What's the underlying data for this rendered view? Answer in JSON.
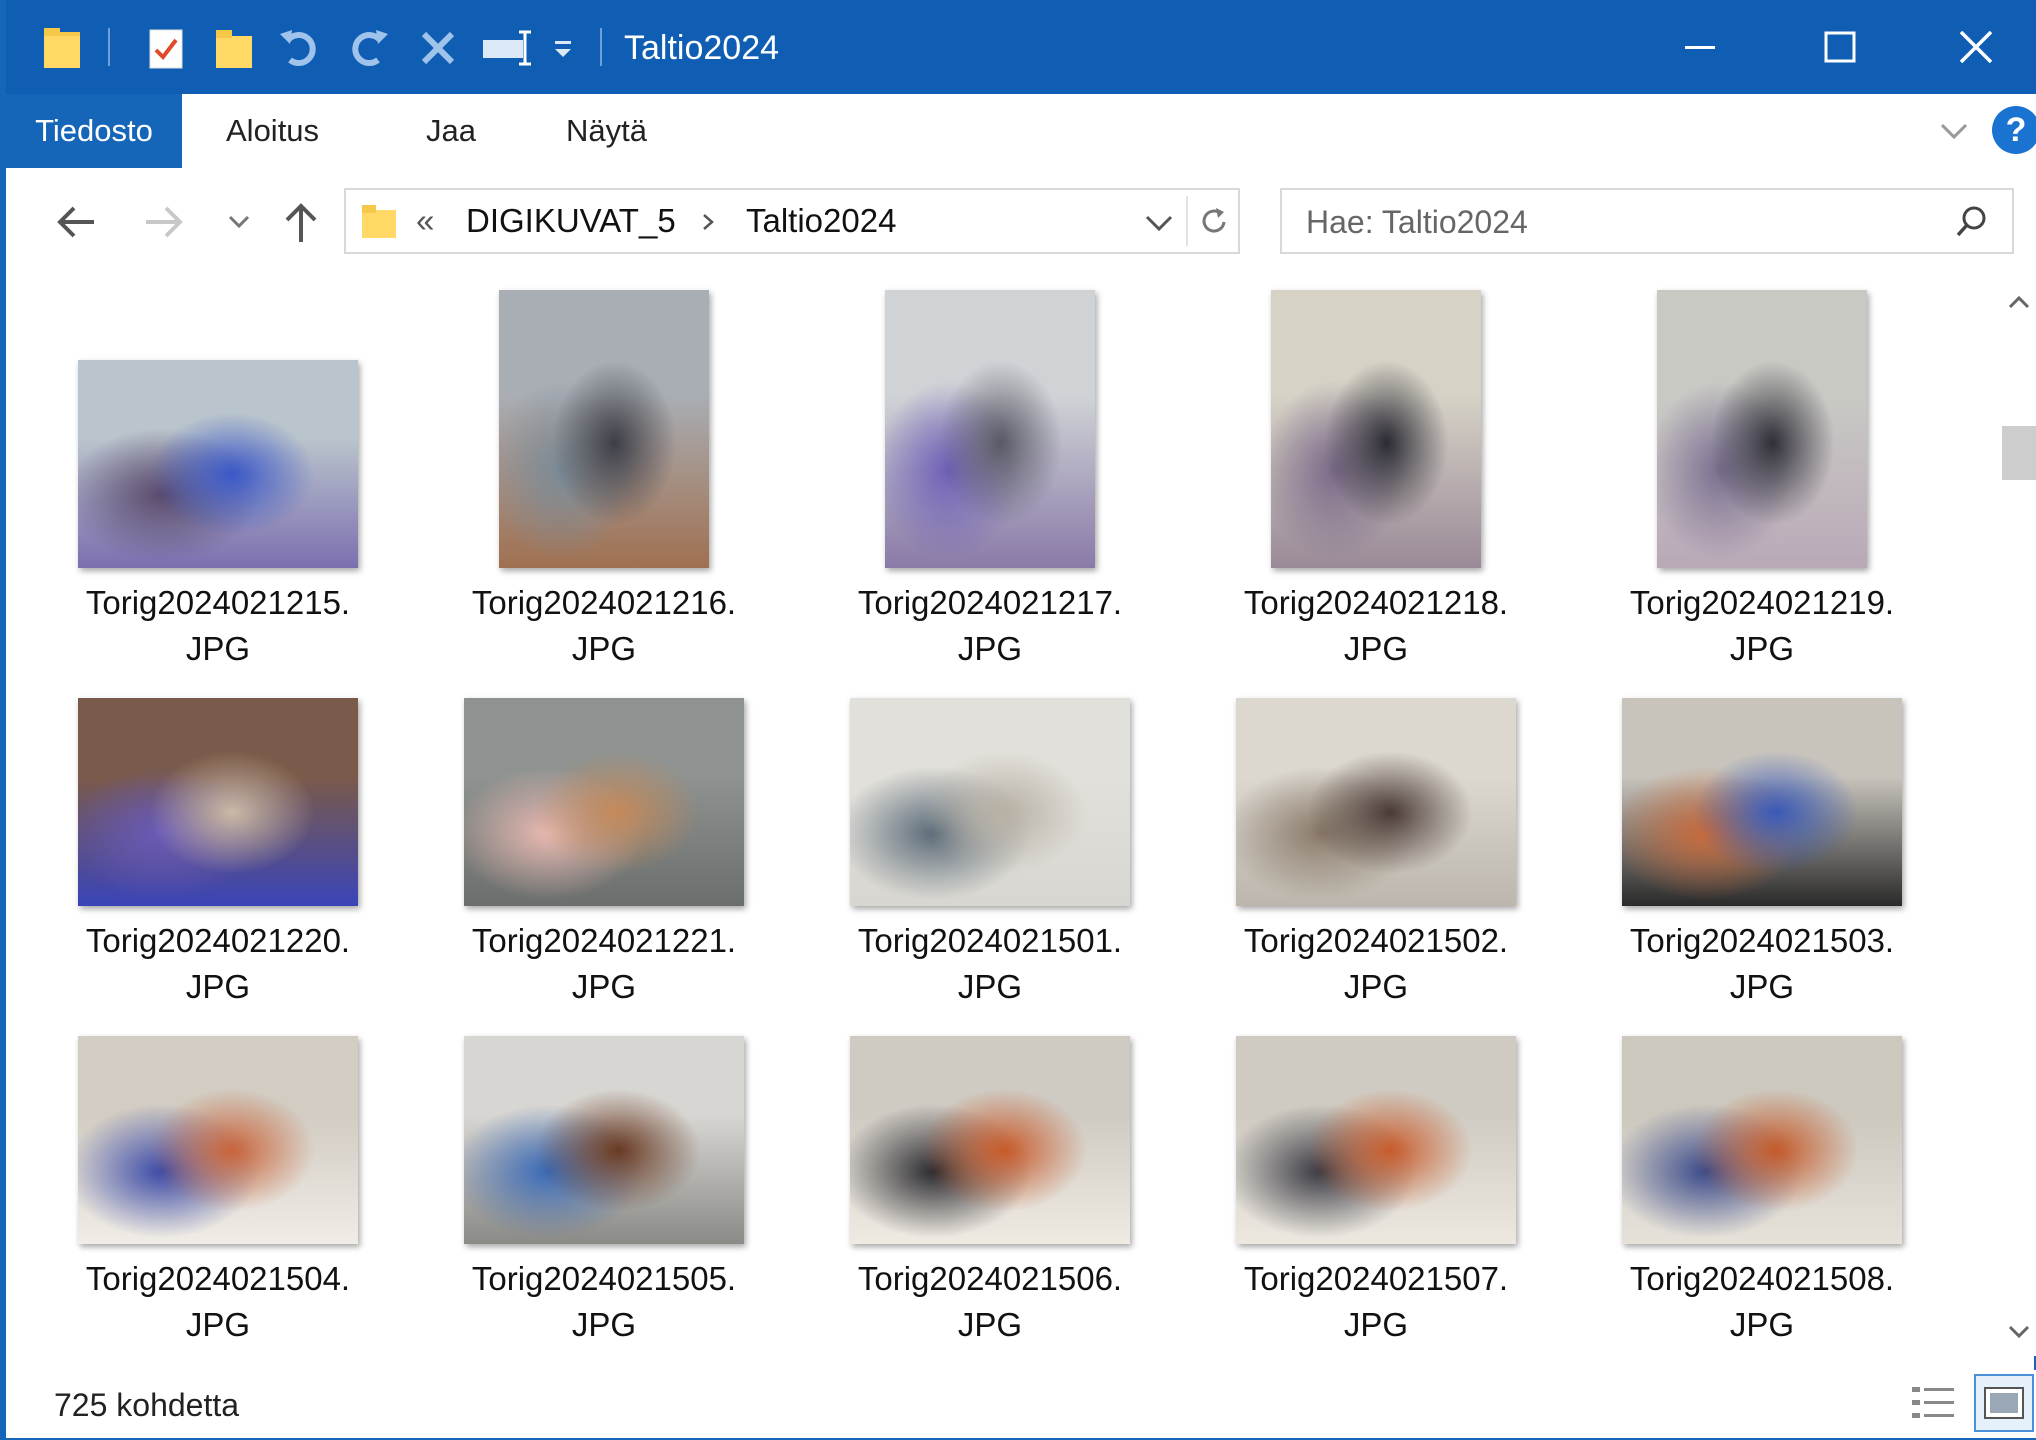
{
  "window": {
    "title": "Taltio2024"
  },
  "ribbon": {
    "tabs": [
      {
        "label": "Tiedosto"
      },
      {
        "label": "Aloitus"
      },
      {
        "label": "Jaa"
      },
      {
        "label": "Näytä"
      }
    ],
    "help_label": "?"
  },
  "address": {
    "overflow": "«",
    "crumbs": [
      "DIGIKUVAT_5",
      "Taltio2024"
    ]
  },
  "search": {
    "placeholder": "Hae: Taltio2024"
  },
  "files": [
    {
      "name": "Torig2024021215.",
      "ext": "JPG",
      "orientation": "landscape",
      "colors": [
        "#b9c4cc",
        "#3a58c8",
        "#5a4a6a",
        "#7c6fb0"
      ]
    },
    {
      "name": "Torig2024021216.",
      "ext": "JPG",
      "orientation": "portrait",
      "colors": [
        "#a9adb4",
        "#3d3f48",
        "#7a8a96",
        "#a07050"
      ]
    },
    {
      "name": "Torig2024021217.",
      "ext": "JPG",
      "orientation": "portrait",
      "colors": [
        "#cfd3d6",
        "#5a5a66",
        "#6f5fb8",
        "#8a7aa8"
      ]
    },
    {
      "name": "Torig2024021218.",
      "ext": "JPG",
      "orientation": "portrait",
      "colors": [
        "#d6d2c6",
        "#2b2b34",
        "#7a6a88",
        "#9a8a98"
      ]
    },
    {
      "name": "Torig2024021219.",
      "ext": "JPG",
      "orientation": "portrait",
      "colors": [
        "#c9c9c4",
        "#2f2f38",
        "#7a6f90",
        "#b9a9b8"
      ]
    },
    {
      "name": "Torig2024021220.",
      "ext": "JPG",
      "orientation": "landscape",
      "colors": [
        "#7a5a4a",
        "#cbb9a6",
        "#6a5ab8",
        "#3a44b8"
      ]
    },
    {
      "name": "Torig2024021221.",
      "ext": "JPG",
      "orientation": "landscape",
      "colors": [
        "#8e9290",
        "#c48a5a",
        "#e8b8b0",
        "#6a6e6c"
      ]
    },
    {
      "name": "Torig2024021501.",
      "ext": "JPG",
      "orientation": "landscape",
      "colors": [
        "#e2e0da",
        "#b7b0a4",
        "#5a6a78",
        "#d8d6d0"
      ]
    },
    {
      "name": "Torig2024021502.",
      "ext": "JPG",
      "orientation": "landscape",
      "colors": [
        "#dcd8d0",
        "#4a3a34",
        "#8a7a6a",
        "#bcb6ac"
      ]
    },
    {
      "name": "Torig2024021503.",
      "ext": "JPG",
      "orientation": "landscape",
      "colors": [
        "#c8c4bc",
        "#3a5ab8",
        "#c86a3a",
        "#2a2a2a"
      ]
    },
    {
      "name": "Torig2024021504.",
      "ext": "JPG",
      "orientation": "landscape",
      "colors": [
        "#d2ccc2",
        "#c8643a",
        "#3a4aa8",
        "#f0ece6"
      ]
    },
    {
      "name": "Torig2024021505.",
      "ext": "JPG",
      "orientation": "landscape",
      "colors": [
        "#d8d6d2",
        "#6a3a22",
        "#3a6ab8",
        "#8a8a86"
      ]
    },
    {
      "name": "Torig2024021506.",
      "ext": "JPG",
      "orientation": "landscape",
      "colors": [
        "#cfcac2",
        "#c85a2a",
        "#2a2a30",
        "#efeae2"
      ]
    },
    {
      "name": "Torig2024021507.",
      "ext": "JPG",
      "orientation": "landscape",
      "colors": [
        "#d0cbc2",
        "#c85c2c",
        "#3a3a44",
        "#ece8e0"
      ]
    },
    {
      "name": "Torig2024021508.",
      "ext": "JPG",
      "orientation": "landscape",
      "colors": [
        "#cdc8be",
        "#c45a2a",
        "#3a4a8a",
        "#e6e2da"
      ]
    }
  ],
  "status": {
    "count_text": "725 kohdetta"
  }
}
